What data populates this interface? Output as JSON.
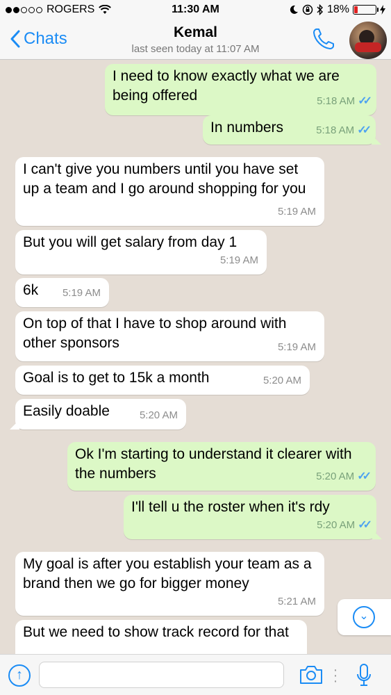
{
  "status_bar": {
    "carrier": "ROGERS",
    "time": "11:30 AM",
    "battery": "18%",
    "battery_level": 0.18
  },
  "nav": {
    "back_label": "Chats",
    "contact_name": "Kemal",
    "last_seen": "last seen today at 11:07 AM"
  },
  "messages": [
    {
      "dir": "out",
      "text": "I need to know exactly what we are being offered",
      "time": "5:18 AM",
      "read": true
    },
    {
      "dir": "out",
      "text": "In numbers",
      "time": "5:18 AM",
      "read": true
    },
    {
      "dir": "in",
      "text": "I can't give you numbers until you have set up a team and I go around shopping for you",
      "time": "5:19 AM"
    },
    {
      "dir": "in",
      "text": "But you will get salary from day 1",
      "time": "5:19 AM"
    },
    {
      "dir": "in",
      "text": "6k",
      "time": "5:19 AM"
    },
    {
      "dir": "in",
      "text": "On top of that I have to shop around with other sponsors",
      "time": "5:19 AM"
    },
    {
      "dir": "in",
      "text": "Goal is to get to 15k a month",
      "time": "5:20 AM"
    },
    {
      "dir": "in",
      "text": "Easily doable",
      "time": "5:20 AM"
    },
    {
      "dir": "out",
      "text": "Ok I'm starting to understand it clearer with the numbers",
      "time": "5:20 AM",
      "read": true
    },
    {
      "dir": "out",
      "text": "I'll tell u the roster when it's rdy",
      "time": "5:20 AM",
      "read": true
    },
    {
      "dir": "in",
      "text": "My goal is after you establish your team as a brand then we go for bigger money",
      "time": "5:21 AM"
    },
    {
      "dir": "in",
      "text": "But we need to show track record for that",
      "time": ""
    }
  ],
  "icons": {
    "read_ticks": "✓✓",
    "scroll_down": "⌄",
    "attach": "↑"
  },
  "colors": {
    "accent": "#1b8cf5",
    "outgoing_bubble": "#dcf8c6",
    "incoming_bubble": "#ffffff",
    "chat_background": "#e5ddd5",
    "battery_low": "#e02020"
  }
}
